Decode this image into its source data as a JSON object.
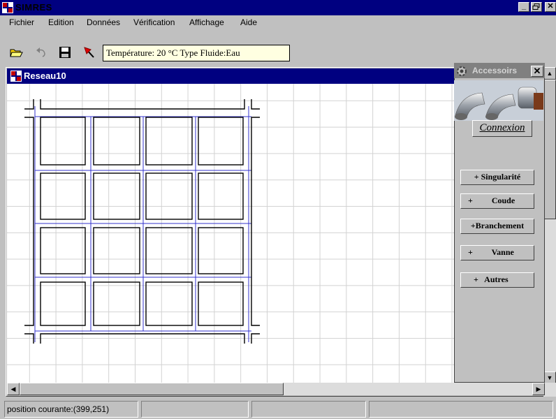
{
  "app": {
    "title": "SIMRES"
  },
  "title_buttons": {
    "minimize": "_",
    "restore": "🗗",
    "close": "✕"
  },
  "menu": {
    "items": [
      {
        "label": "Fichier"
      },
      {
        "label": "Edition"
      },
      {
        "label": "Données"
      },
      {
        "label": "Vérification"
      },
      {
        "label": "Affichage"
      },
      {
        "label": "Aide"
      }
    ]
  },
  "toolbar": {
    "tools": [
      {
        "icon": "open-folder-icon"
      },
      {
        "icon": "undo-icon"
      },
      {
        "icon": "save-icon"
      },
      {
        "icon": "pointer-arrow-icon"
      }
    ],
    "info": "Température: 20 °C    Type Fluide:Eau"
  },
  "child_window": {
    "title": "Reseau10"
  },
  "palette": {
    "title": "Accessoirs",
    "close_label": "✕",
    "tab_label": "Connexion",
    "buttons": [
      {
        "label": "+ Singularité"
      },
      {
        "label": "+         Coude"
      },
      {
        "label": "+Branchement"
      },
      {
        "label": "+         Vanne"
      },
      {
        "label": "+   Autres"
      }
    ]
  },
  "status_bar": {
    "position": "position courante:(399,251)",
    "panels": [
      "",
      "",
      "",
      ""
    ]
  },
  "colors": {
    "title_active": "#000080",
    "title_inactive": "#808080",
    "grid": "#d2d2d2",
    "pipe": "#000000",
    "pipe_guide": "#3333cc",
    "info_box": "#ffffe1"
  }
}
